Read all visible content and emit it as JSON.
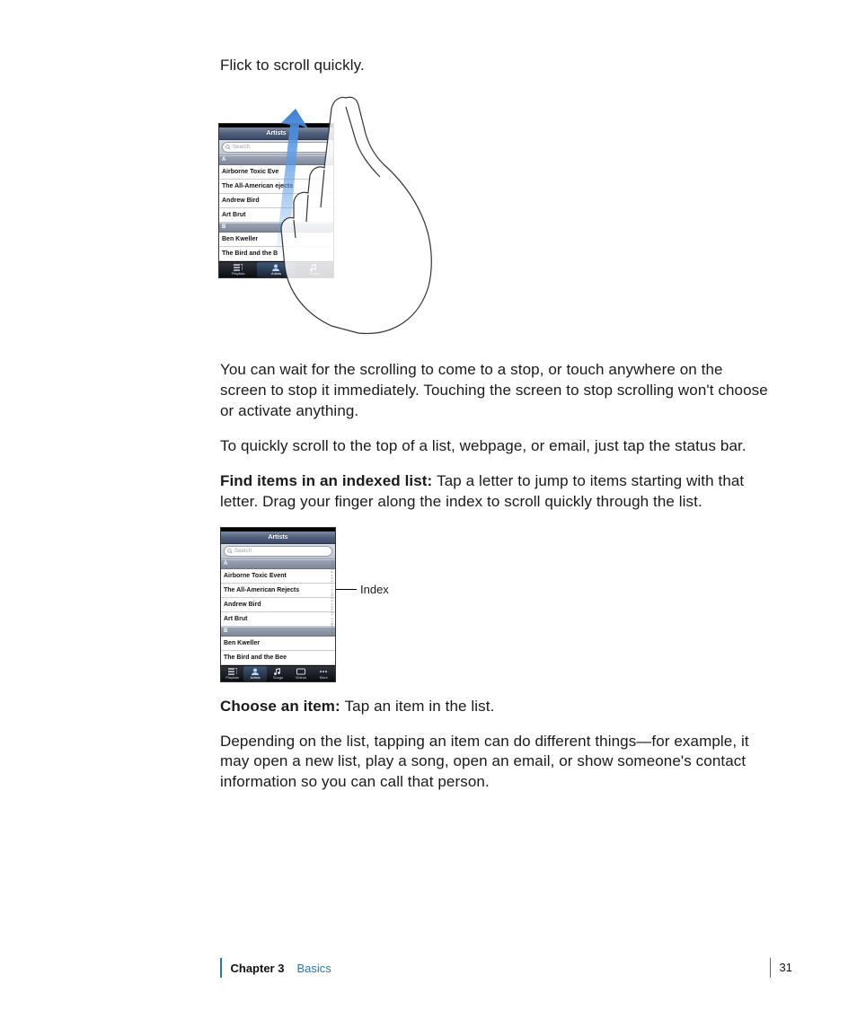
{
  "paragraphs": {
    "p1": "Flick to scroll quickly.",
    "p2": "You can wait for the scrolling to come to a stop, or touch anywhere on the screen to stop it immediately. Touching the screen to stop scrolling won't choose or activate anything.",
    "p3": "To quickly scroll to the top of a list, webpage, or email, just tap the status bar.",
    "p4_lead": "Find items in an indexed list:  ",
    "p4_rest": "Tap a letter to jump to items starting with that letter. Drag your finger along the index to scroll quickly through the list.",
    "p5_lead": "Choose an item:  ",
    "p5_rest": "Tap an item in the list.",
    "p6": "Depending on the list, tapping an item can do different things—for example, it may open a new list, play a song, open an email, or show someone's contact information so you can call that person."
  },
  "callout": {
    "index_label": "Index"
  },
  "phone": {
    "title": "Artists",
    "search_placeholder": "Search",
    "sections": [
      {
        "letter": "A",
        "rows": [
          "Airborne Toxic Event",
          "The All-American Rejects",
          "Andrew Bird",
          "Art Brut"
        ]
      },
      {
        "letter": "B",
        "rows": [
          "Ben Kweller",
          "The Bird and the Bee"
        ]
      }
    ],
    "phone1_sections": [
      {
        "letter": "A",
        "rows": [
          "Airborne Toxic Eve",
          "The All-American     ejects",
          "Andrew Bird",
          "Art Brut"
        ]
      },
      {
        "letter": "B",
        "rows": [
          "Ben Kweller",
          "The Bird and the B"
        ]
      }
    ],
    "index_letters": "ABCDEFGHIJKLMNOPQRSTUVWXYZ#",
    "tabs_short": [
      "Playlists",
      "Artists",
      "Songs"
    ],
    "tabs_full": [
      "Playlists",
      "Artists",
      "Songs",
      "Videos",
      "More"
    ]
  },
  "footer": {
    "chapter_label": "Chapter 3",
    "chapter_name": "Basics",
    "page_number": "31"
  }
}
